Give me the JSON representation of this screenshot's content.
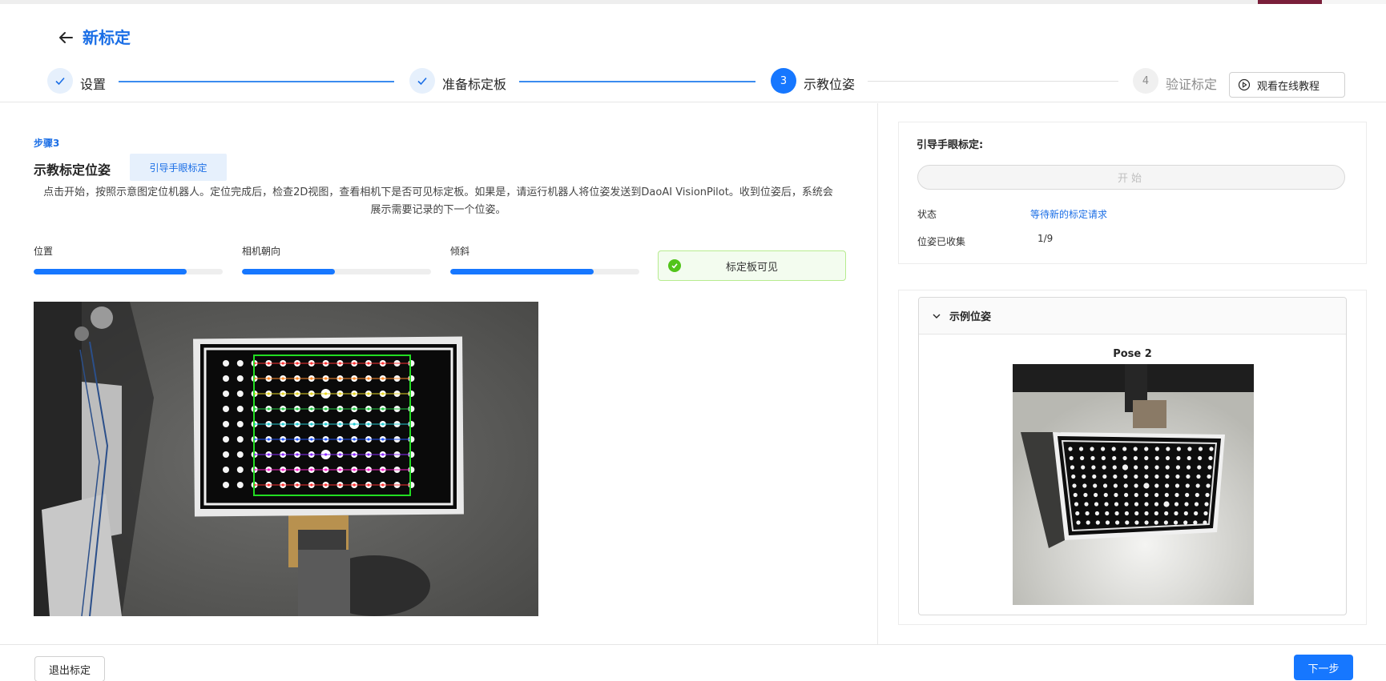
{
  "header": {
    "title": "新标定",
    "tutorial_label": "观看在线教程"
  },
  "steps": [
    {
      "number": "1",
      "label": "设置",
      "state": "done"
    },
    {
      "number": "2",
      "label": "准备标定板",
      "state": "done"
    },
    {
      "number": "3",
      "label": "示教位姿",
      "state": "active"
    },
    {
      "number": "4",
      "label": "验证标定",
      "state": "pending"
    }
  ],
  "main": {
    "step_tag": "步骤3",
    "section_title": "示教标定位姿",
    "guide_badge": "引导手眼标定",
    "instruction": "点击开始，按照示意图定位机器人。定位完成后，检查2D视图，查看相机下是否可见标定板。如果是，请运行机器人将位姿发送到DaoAI VisionPilot。收到位姿后，系统会展示需要记录的下一个位姿。",
    "metrics": [
      {
        "label": "位置",
        "progress": 0.81
      },
      {
        "label": "相机朝向",
        "progress": 0.49
      },
      {
        "label": "倾斜",
        "progress": 0.76
      }
    ],
    "board_visible_label": "标定板可见"
  },
  "guide_card": {
    "title": "引导手眼标定:",
    "start_label": "开始",
    "status_label": "状态",
    "status_value": "等待新的标定请求",
    "collected_label": "位姿已收集",
    "collected_value": "1/9"
  },
  "example_card": {
    "title": "示例位姿",
    "pose_title": "Pose 2"
  },
  "footer": {
    "exit_label": "退出标定",
    "next_label": "下一步"
  },
  "colors": {
    "primary": "#1677ff",
    "link": "#1a6ee6",
    "success": "#52c41a"
  }
}
